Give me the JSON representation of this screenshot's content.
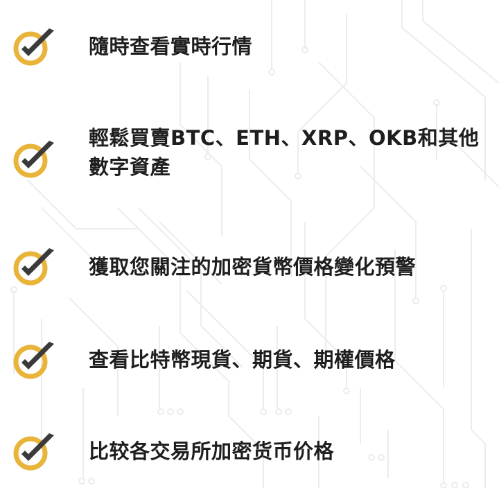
{
  "features": [
    {
      "label": "隨時查看實時行情"
    },
    {
      "label": "輕鬆買賣BTC、ETH、XRP、OKB和其他數字資產"
    },
    {
      "label": "獲取您關注的加密貨幣價格變化預警"
    },
    {
      "label": "查看比特幣現貨、期貨、期權價格"
    },
    {
      "label": "比较各交易所加密货币价格"
    }
  ],
  "colors": {
    "check_ring": "#e9b43a",
    "check_mark": "#3a3a3a",
    "text": "#1e1e1e",
    "circuit": "#ececec"
  },
  "icons": {
    "check": "check-circle-icon"
  }
}
